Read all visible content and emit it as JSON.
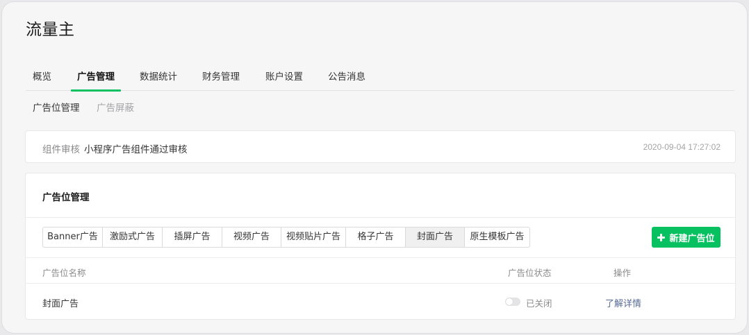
{
  "app": {
    "title": "流量主"
  },
  "main_tabs": [
    {
      "label": "概览"
    },
    {
      "label": "广告管理"
    },
    {
      "label": "数据统计"
    },
    {
      "label": "财务管理"
    },
    {
      "label": "账户设置"
    },
    {
      "label": "公告消息"
    }
  ],
  "sub_tabs": [
    {
      "label": "广告位管理"
    },
    {
      "label": "广告屏蔽"
    }
  ],
  "notice": {
    "label": "组件审核",
    "text": "小程序广告组件通过审核",
    "time": "2020-09-04 17:27:02"
  },
  "manage": {
    "title": "广告位管理",
    "ad_types": [
      {
        "label": "Banner广告"
      },
      {
        "label": "激励式广告"
      },
      {
        "label": "插屏广告"
      },
      {
        "label": "视频广告"
      },
      {
        "label": "视频贴片广告"
      },
      {
        "label": "格子广告"
      },
      {
        "label": "封面广告"
      },
      {
        "label": "原生模板广告"
      }
    ],
    "selected_type": "封面广告",
    "new_button": "新建广告位",
    "columns": {
      "name": "广告位名称",
      "status": "广告位状态",
      "action": "操作"
    },
    "rows": [
      {
        "name": "封面广告",
        "status": "已关闭",
        "action": "了解详情"
      }
    ]
  },
  "colors": {
    "accent": "#07c160",
    "link": "#576b95"
  }
}
